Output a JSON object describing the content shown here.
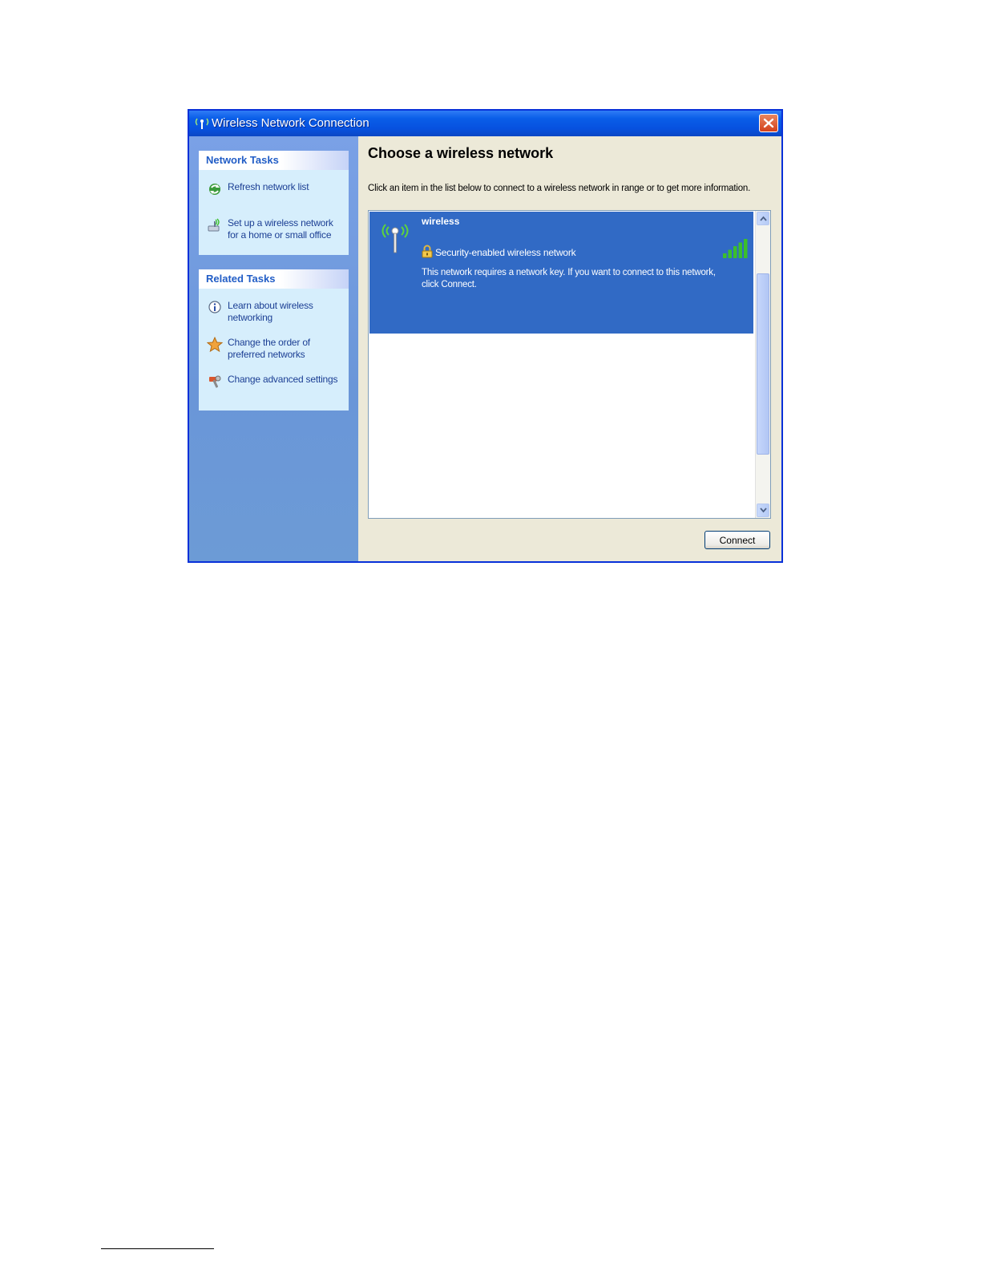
{
  "window": {
    "title": "Wireless Network Connection"
  },
  "sidebar": {
    "network_tasks": {
      "header": "Network Tasks",
      "items": [
        {
          "label": "Refresh network list",
          "icon": "refresh-icon"
        },
        {
          "label": "Set up a wireless network for a home or small office",
          "icon": "setup-network-icon"
        }
      ]
    },
    "related_tasks": {
      "header": "Related Tasks",
      "items": [
        {
          "label": "Learn about wireless networking",
          "icon": "info-icon"
        },
        {
          "label": "Change the order of preferred networks",
          "icon": "star-icon"
        },
        {
          "label": "Change advanced settings",
          "icon": "settings-icon"
        }
      ]
    }
  },
  "main": {
    "title": "Choose a wireless network",
    "description": "Click an item in the list below to connect to a wireless network in range or to get more information.",
    "networks": [
      {
        "name": "wireless",
        "security": "Security-enabled wireless network",
        "description": "This network requires a network key. If you want to connect to this network, click Connect.",
        "signal_bars": 5,
        "selected": true
      }
    ],
    "connect_label": "Connect"
  },
  "colors": {
    "titlebar": "#0a5ee8",
    "selection": "#316ac5",
    "sidebar": "#6a96d8",
    "panel": "#d6eefc",
    "link": "#1c3f94",
    "signal": "#3cbf2b"
  }
}
